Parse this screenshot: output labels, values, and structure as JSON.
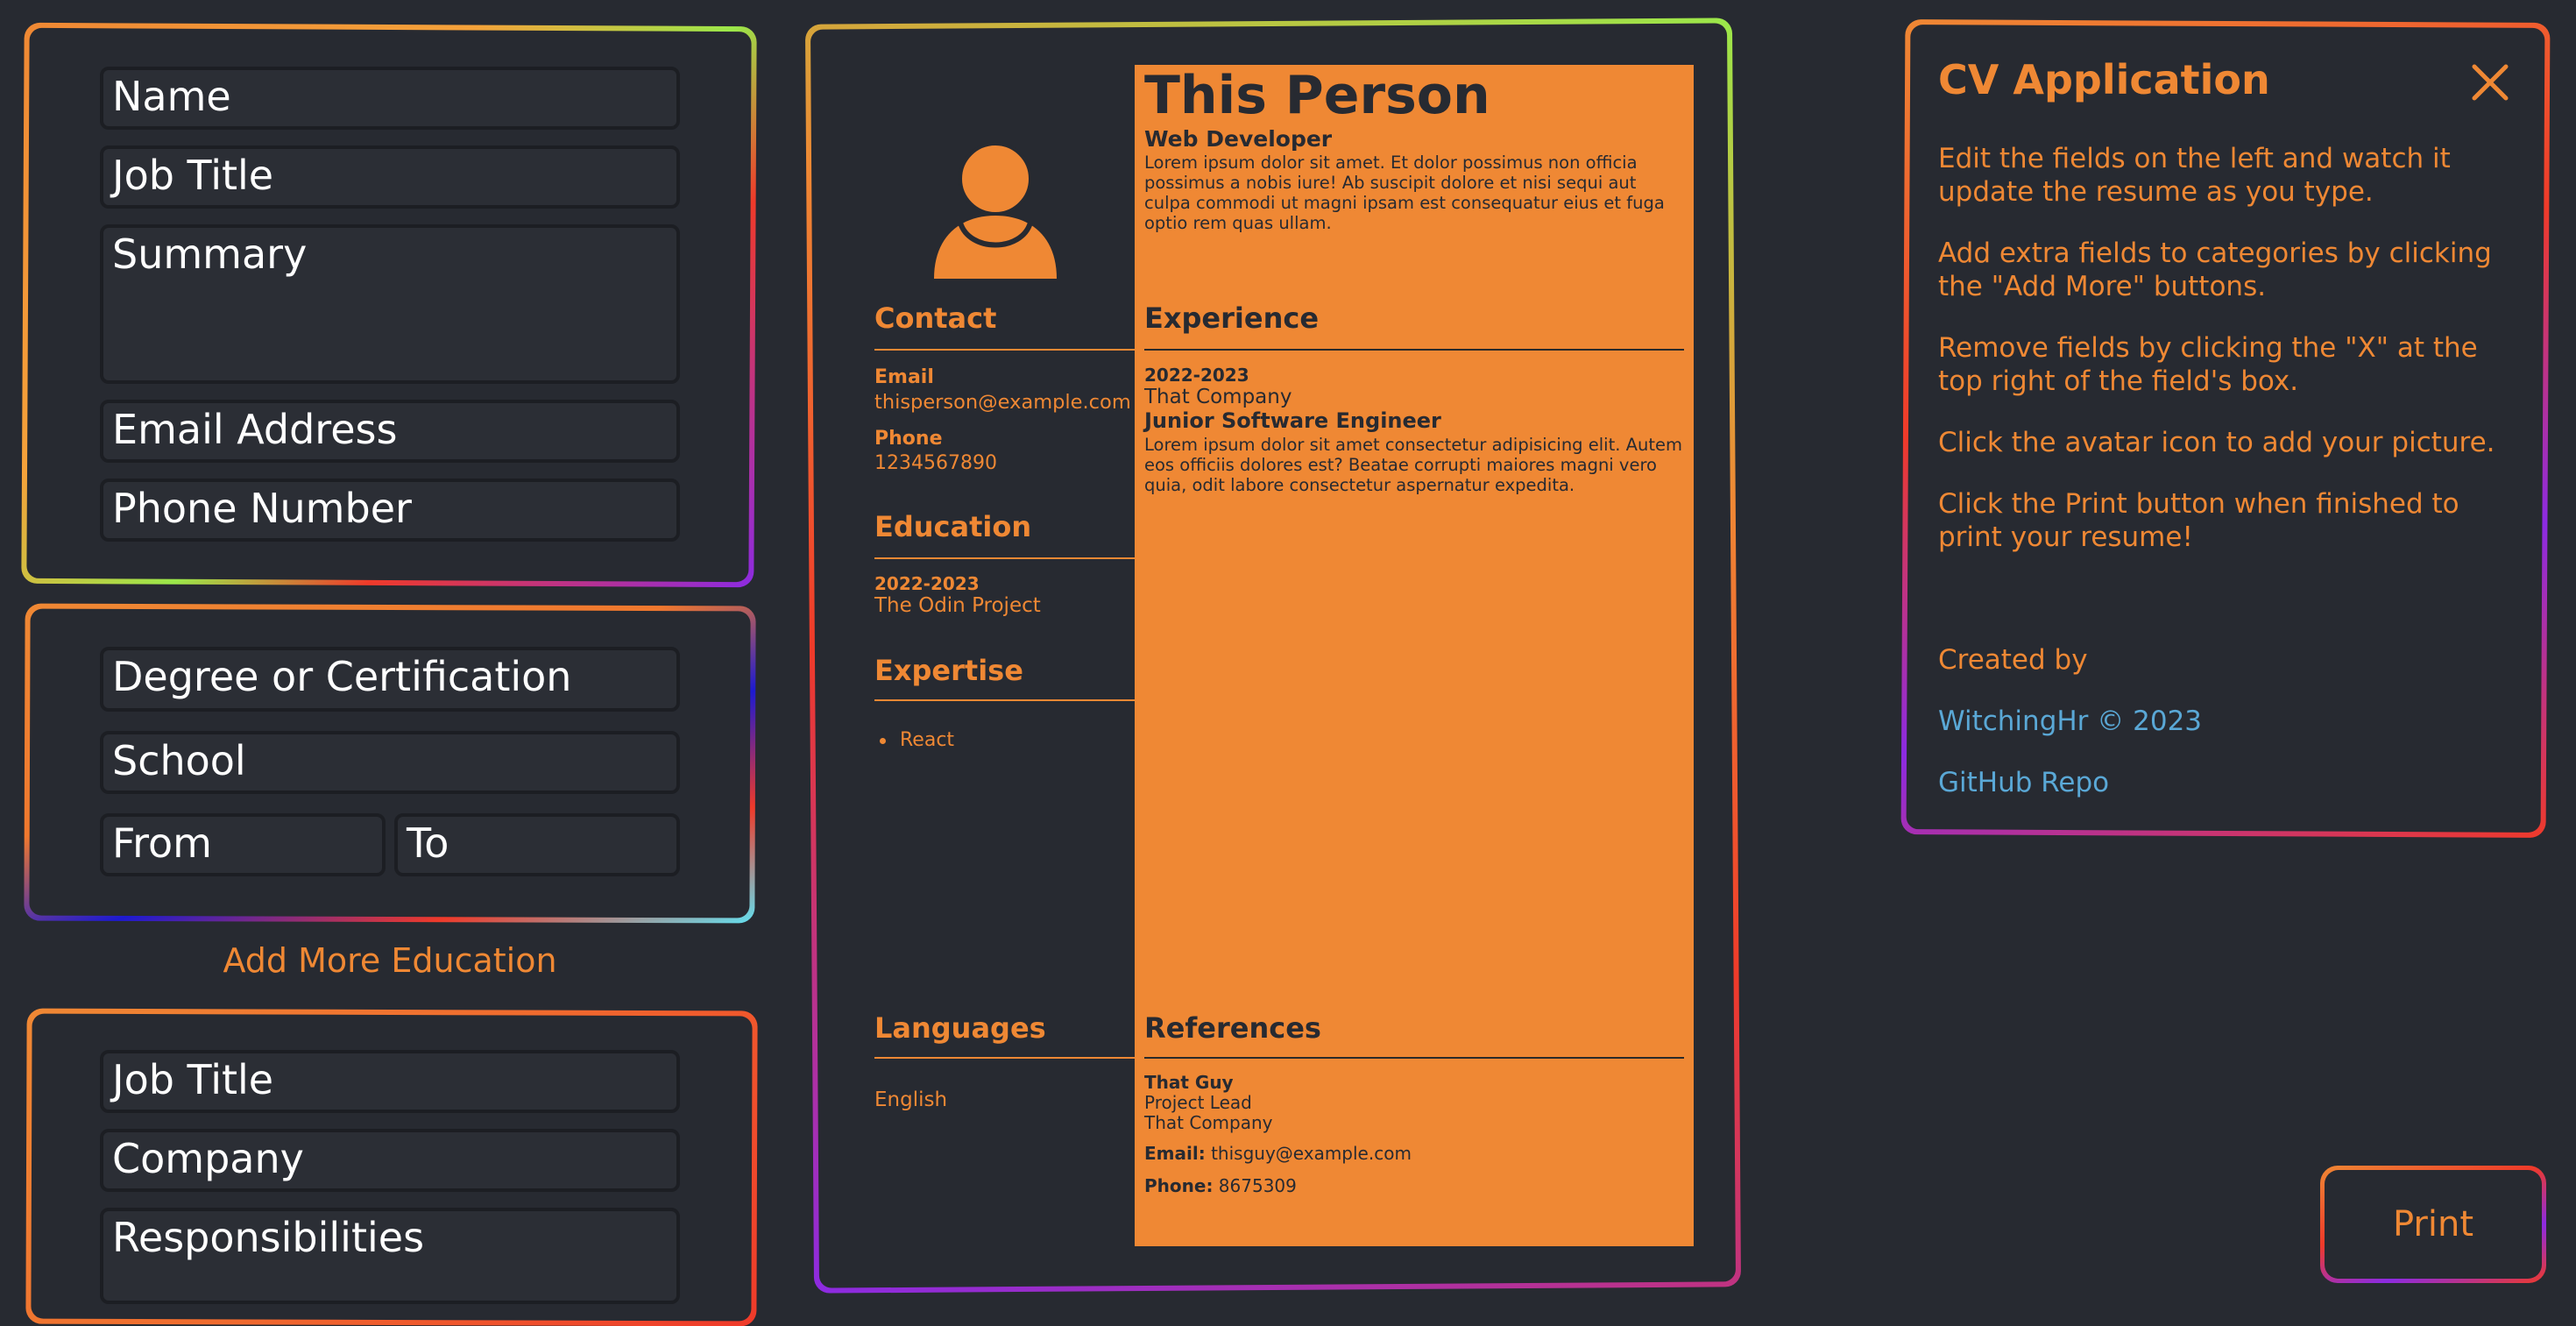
{
  "personal_form": {
    "name_placeholder": "Name",
    "job_title_placeholder": "Job Title",
    "summary_placeholder": "Summary",
    "email_placeholder": "Email Address",
    "phone_placeholder": "Phone Number"
  },
  "education_form": {
    "degree_placeholder": "Degree or Certification",
    "school_placeholder": "School",
    "from_placeholder": "From",
    "to_placeholder": "To",
    "add_more_label": "Add More Education"
  },
  "experience_form": {
    "job_title_placeholder": "Job Title",
    "company_placeholder": "Company",
    "responsibilities_placeholder": "Responsibilities"
  },
  "resume": {
    "name": "This Person",
    "title": "Web Developer",
    "summary": "Lorem ipsum dolor sit amet. Et dolor possimus non officia possimus a nobis iure! Ab suscipit dolore et nisi sequi aut culpa commodi ut magni ipsam est consequatur eius et fuga optio rem quas ullam.",
    "contact_heading": "Contact",
    "email_label": "Email",
    "email": "thisperson@example.com",
    "phone_label": "Phone",
    "phone": "1234567890",
    "education_heading": "Education",
    "education_dates": "2022-2023",
    "education_school": "The Odin Project",
    "expertise_heading": "Expertise",
    "expertise_items": [
      "React"
    ],
    "languages_heading": "Languages",
    "language": "English",
    "experience_heading": "Experience",
    "experience_dates": "2022-2023",
    "experience_company": "That Company",
    "experience_role": "Junior Software Engineer",
    "experience_desc": "Lorem ipsum dolor sit amet consectetur adipisicing elit. Autem eos officiis dolores est? Beatae corrupti maiores magni vero quia, odit labore consectetur aspernatur expedita.",
    "references_heading": "References",
    "ref_name": "That Guy",
    "ref_role": "Project Lead",
    "ref_company": "That Company",
    "ref_email_label": "Email:",
    "ref_email": "thisguy@example.com",
    "ref_phone_label": "Phone:",
    "ref_phone": "8675309"
  },
  "info_panel": {
    "title": "CV Application",
    "p1": "Edit the fields on the left and watch it update the resume as you type.",
    "p2": "Add extra fields to categories by clicking the \"Add More\" buttons.",
    "p3": "Remove fields by clicking the \"X\" at the top right of the field's box.",
    "p4": "Click the avatar icon to add your picture.",
    "p5": "Click the Print button when finished to print your resume!",
    "created_by": "Created by",
    "author_link": "WitchingHr © 2023",
    "repo_link": "GitHub Repo"
  },
  "print_label": "Print",
  "colors": {
    "background": "#272a31",
    "accent": "#ef8834",
    "link": "#5aa8d6"
  }
}
